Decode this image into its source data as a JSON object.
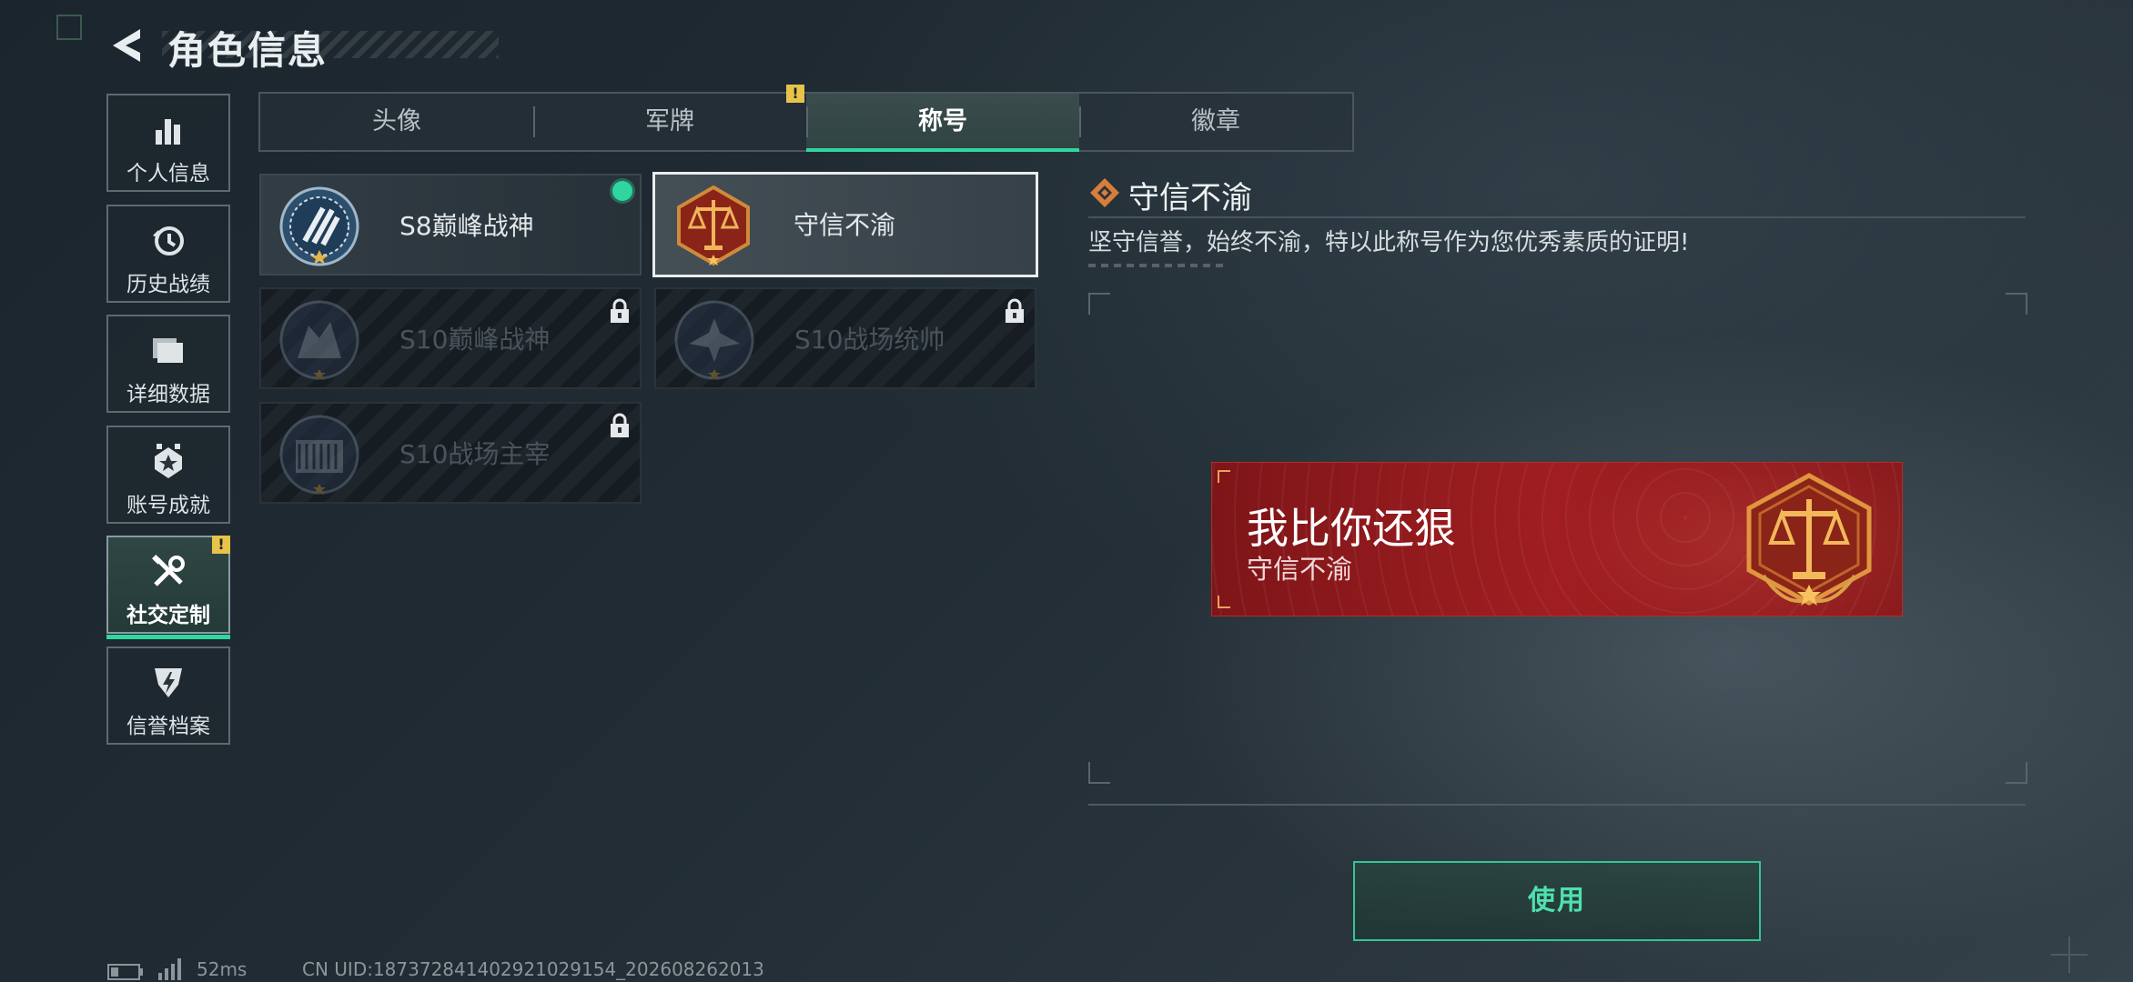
{
  "header": {
    "title": "角色信息"
  },
  "sidebar": {
    "items": [
      {
        "label": "个人信息",
        "icon": "bar-chart-icon"
      },
      {
        "label": "历史战绩",
        "icon": "history-clock-icon"
      },
      {
        "label": "详细数据",
        "icon": "folder-icon"
      },
      {
        "label": "账号成就",
        "icon": "achievement-icon"
      },
      {
        "label": "社交定制",
        "icon": "tools-icon",
        "active": true,
        "alert": "!"
      },
      {
        "label": "信誉档案",
        "icon": "credit-shield-icon"
      }
    ]
  },
  "tabs": [
    {
      "label": "头像"
    },
    {
      "label": "军牌",
      "alert": "!"
    },
    {
      "label": "称号",
      "active": true
    },
    {
      "label": "徽章"
    }
  ],
  "titles": [
    {
      "name": "S8巅峰战神",
      "state": "equipped"
    },
    {
      "name": "守信不渝",
      "state": "selected"
    },
    {
      "name": "S10巅峰战神",
      "state": "locked"
    },
    {
      "name": "S10战场统帅",
      "state": "locked"
    },
    {
      "name": "S10战场主宰",
      "state": "locked"
    }
  ],
  "detail": {
    "title": "守信不渝",
    "description": "坚守信誉，始终不渝，特以此称号作为您优秀素质的证明!"
  },
  "banner": {
    "main_text": "我比你还狠",
    "sub_text": "守信不渝"
  },
  "use_button": {
    "label": "使用"
  },
  "footer": {
    "ping": "52ms",
    "uid": "CN UID:18737284140292102915‍4_202608262013"
  },
  "colors": {
    "accent": "#2fd6a0",
    "warning": "#e8c34a",
    "banner_red": "#a01e21"
  }
}
